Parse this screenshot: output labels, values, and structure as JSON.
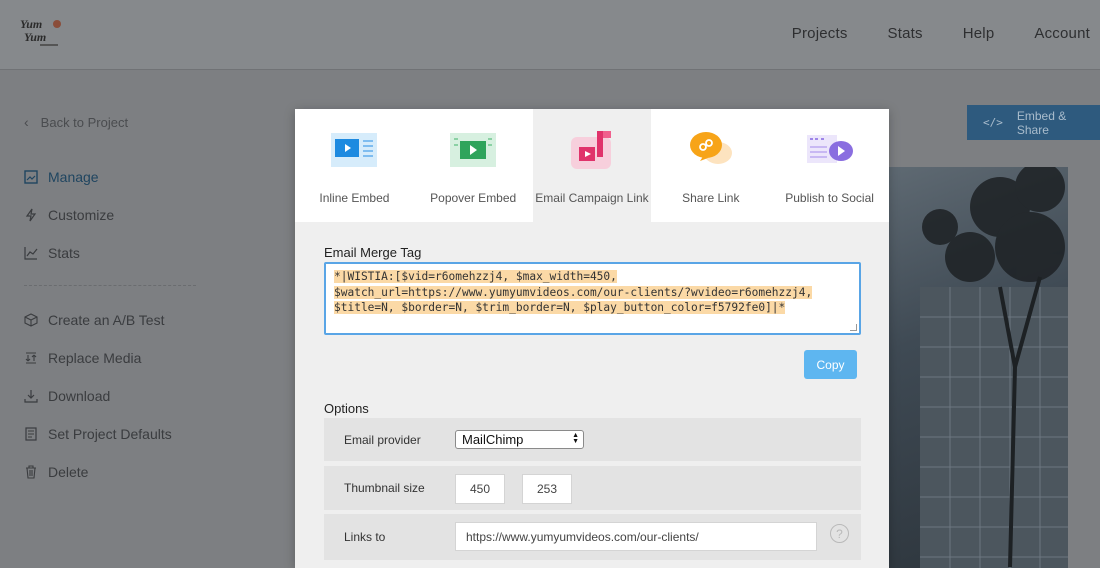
{
  "header": {
    "nav": [
      "Projects",
      "Stats",
      "Help",
      "Account"
    ]
  },
  "sidebar": {
    "back_label": "Back to Project",
    "items": [
      {
        "label": "Manage",
        "icon": "image-icon"
      },
      {
        "label": "Customize",
        "icon": "bolt-icon"
      },
      {
        "label": "Stats",
        "icon": "line-chart-icon"
      },
      {
        "label": "Create an A/B Test",
        "icon": "cube-icon"
      },
      {
        "label": "Replace Media",
        "icon": "replace-icon"
      },
      {
        "label": "Download",
        "icon": "download-icon"
      },
      {
        "label": "Set Project Defaults",
        "icon": "document-icon"
      },
      {
        "label": "Delete",
        "icon": "trash-icon"
      }
    ]
  },
  "embed_share_button": "Embed & Share",
  "modal": {
    "tabs": [
      {
        "label": "Inline Embed",
        "icon": "inline-embed-icon"
      },
      {
        "label": "Popover Embed",
        "icon": "popover-embed-icon"
      },
      {
        "label": "Email Campaign Link",
        "icon": "email-campaign-icon",
        "active": true
      },
      {
        "label": "Share Link",
        "icon": "share-link-icon"
      },
      {
        "label": "Publish to Social",
        "icon": "publish-social-icon"
      }
    ],
    "merge_tag_label": "Email Merge Tag",
    "merge_tag_lines": [
      "*|WISTIA:[$vid=r6omehzzj4, $max_width=450, ",
      "$watch_url=https://www.yumyumvideos.com/our-clients/?wvideo=r6omehzzj4, ",
      "$title=N, $border=N, $trim_border=N, $play_button_color=f5792fe0]|*"
    ],
    "copy_label": "Copy",
    "options_label": "Options",
    "options": {
      "email_provider_label": "Email provider",
      "email_provider_value": "MailChimp",
      "thumbnail_size_label": "Thumbnail size",
      "thumbnail_width": "450",
      "thumbnail_height": "253",
      "times": "×",
      "links_to_label": "Links to",
      "links_to_value": "https://www.yumyumvideos.com/our-clients/",
      "help": "?"
    }
  },
  "colors": {
    "accent": "#54aee8",
    "copy_button": "#5eb6f0",
    "highlight": "#fbd9a6",
    "overlay": "#7d7f82"
  }
}
